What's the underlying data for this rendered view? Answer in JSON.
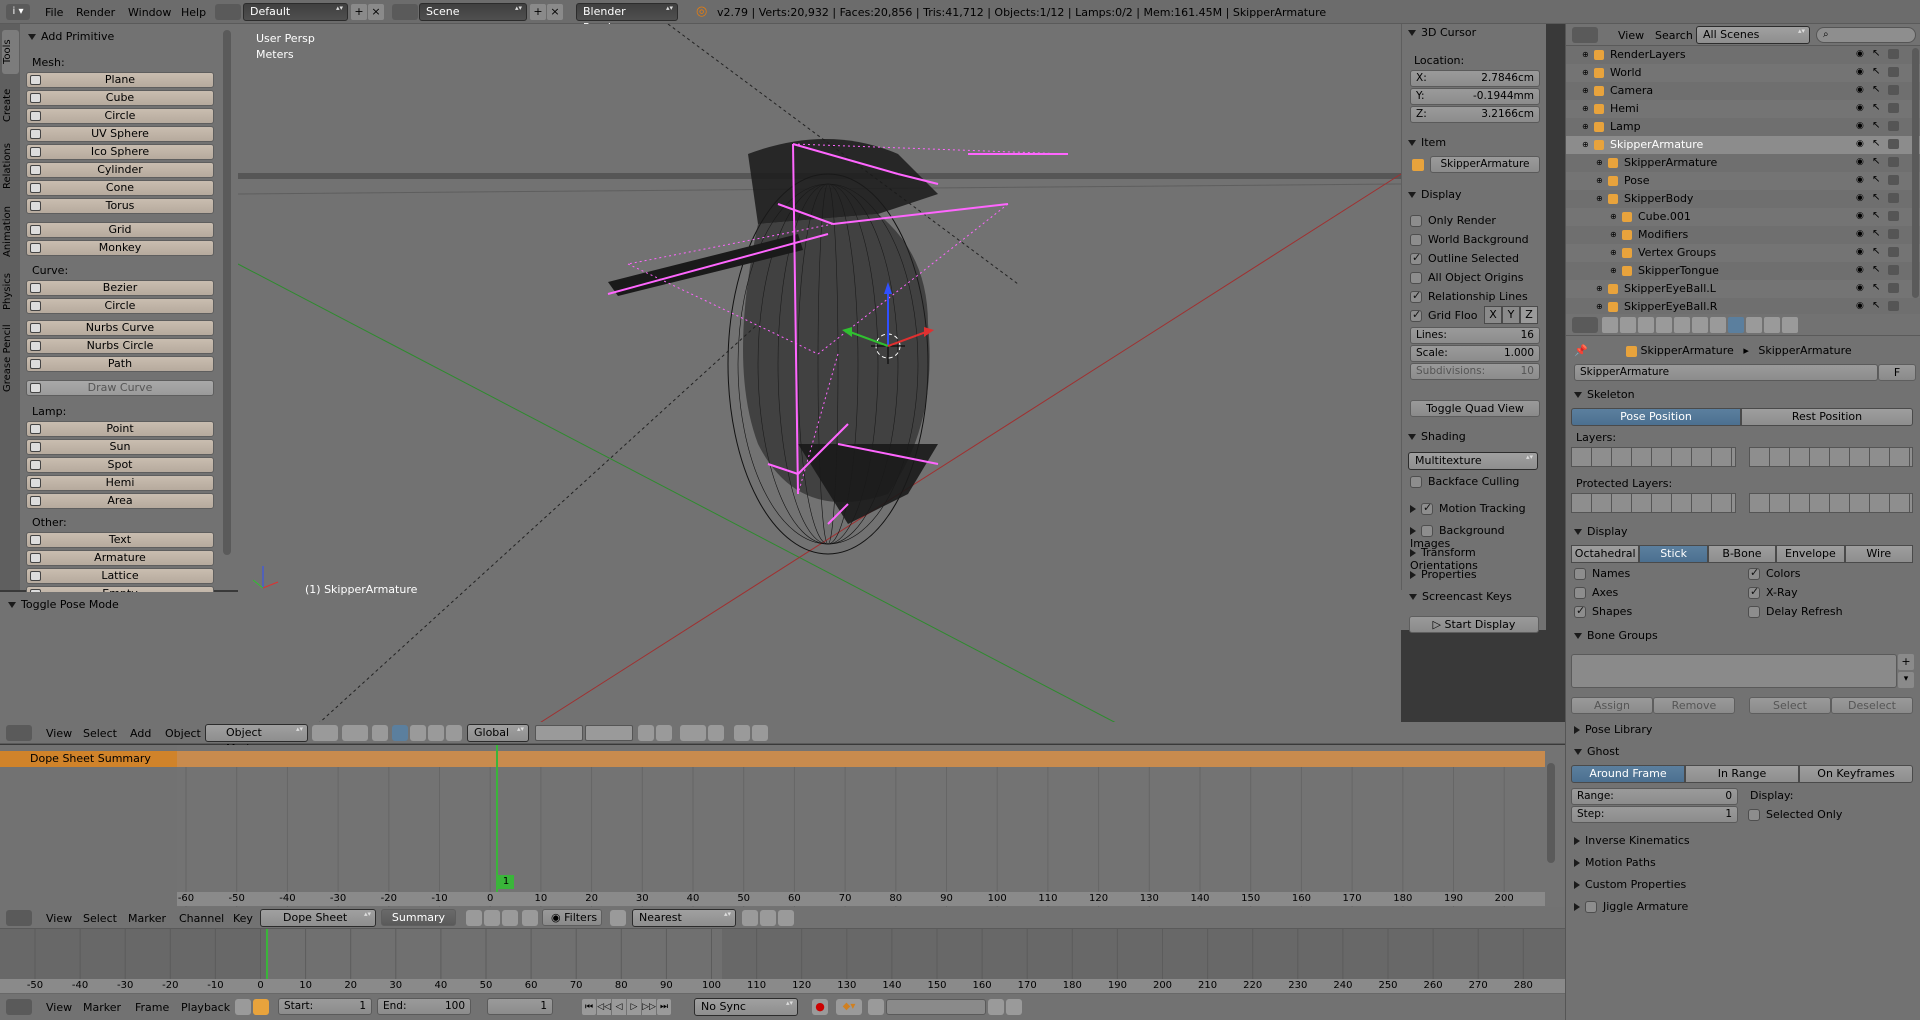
{
  "topbar": {
    "menus": [
      "File",
      "Render",
      "Window",
      "Help"
    ],
    "layout": "Default",
    "scene": "Scene",
    "engine": "Blender Render",
    "stats": "v2.79 | Verts:20,932 | Faces:20,856 | Tris:41,712 | Objects:1/12 | Lamps:0/2 | Mem:161.45M | SkipperArmature"
  },
  "toolshelf": {
    "tabs": [
      "Tools",
      "Create",
      "Relations",
      "Animation",
      "Physics",
      "Grease Pencil"
    ],
    "title": "Add Primitive",
    "mesh_label": "Mesh:",
    "mesh": [
      "Plane",
      "Cube",
      "Circle",
      "UV Sphere",
      "Ico Sphere",
      "Cylinder",
      "Cone",
      "Torus"
    ],
    "mesh2": [
      "Grid",
      "Monkey"
    ],
    "curve_label": "Curve:",
    "curve1": [
      "Bezier",
      "Circle"
    ],
    "curve2": [
      "Nurbs Curve",
      "Nurbs Circle",
      "Path"
    ],
    "draw_curve": "Draw Curve",
    "lamp_label": "Lamp:",
    "lamp": [
      "Point",
      "Sun",
      "Spot",
      "Hemi",
      "Area"
    ],
    "other_label": "Other:",
    "other": [
      "Text",
      "Armature",
      "Lattice",
      "Empty"
    ],
    "operator": "Toggle Pose Mode"
  },
  "viewport": {
    "view_name": "User Persp",
    "units": "Meters",
    "object_label": "(1) SkipperArmature",
    "header_menus": [
      "View",
      "Select",
      "Add",
      "Object"
    ],
    "mode": "Object Mode",
    "orientation": "Global"
  },
  "properties_n": {
    "cursor_title": "3D Cursor",
    "location": "Location:",
    "x": "X:",
    "xv": "2.7846cm",
    "y": "Y:",
    "yv": "-0.1944mm",
    "z": "Z:",
    "zv": "3.2166cm",
    "item_title": "Item",
    "item_name": "SkipperArmature",
    "display_title": "Display",
    "opts": [
      {
        "label": "Only Render",
        "on": false
      },
      {
        "label": "World Background",
        "on": false
      },
      {
        "label": "Outline Selected",
        "on": true
      },
      {
        "label": "All Object Origins",
        "on": false
      },
      {
        "label": "Relationship Lines",
        "on": true
      }
    ],
    "grid_floor": "Grid Floo",
    "axes": [
      "X",
      "Y",
      "Z"
    ],
    "lines_l": "Lines:",
    "lines_v": "16",
    "scale_l": "Scale:",
    "scale_v": "1.000",
    "subdiv_l": "Subdivisions:",
    "subdiv_v": "10",
    "quad": "Toggle Quad View",
    "shading_title": "Shading",
    "shading_mode": "Multitexture",
    "backface": "Backface Culling",
    "motion_tracking": "Motion Tracking",
    "background_images": "Background Images",
    "transform_orient": "Transform Orientations",
    "properties": "Properties",
    "screencast": "Screencast Keys",
    "start_display": "Start Display"
  },
  "outliner": {
    "menus": [
      "View",
      "Search"
    ],
    "filter": "All Scenes",
    "items": [
      {
        "name": "RenderLayers",
        "indent": 1
      },
      {
        "name": "World",
        "indent": 1
      },
      {
        "name": "Camera",
        "indent": 1
      },
      {
        "name": "Hemi",
        "indent": 1
      },
      {
        "name": "Lamp",
        "indent": 1
      },
      {
        "name": "SkipperArmature",
        "indent": 1,
        "sel": true
      },
      {
        "name": "SkipperArmature",
        "indent": 2
      },
      {
        "name": "Pose",
        "indent": 2
      },
      {
        "name": "SkipperBody",
        "indent": 2
      },
      {
        "name": "Cube.001",
        "indent": 3
      },
      {
        "name": "Modifiers",
        "indent": 3
      },
      {
        "name": "Vertex Groups",
        "indent": 3
      },
      {
        "name": "SkipperTongue",
        "indent": 3
      },
      {
        "name": "SkipperEyeBall.L",
        "indent": 2
      },
      {
        "name": "SkipperEyeBall.R",
        "indent": 2
      }
    ]
  },
  "props": {
    "breadcrumb1": "SkipperArmature",
    "breadcrumb2": "SkipperArmature",
    "name": "SkipperArmature",
    "fake": "F",
    "skeleton": "Skeleton",
    "pose_position": "Pose Position",
    "rest_position": "Rest Position",
    "layers": "Layers:",
    "protected_layers": "Protected Layers:",
    "display": "Display",
    "display_modes": [
      "Octahedral",
      "Stick",
      "B-Bone",
      "Envelope",
      "Wire"
    ],
    "names": "Names",
    "axes": "Axes",
    "shapes": "Shapes",
    "colors": "Colors",
    "xray": "X-Ray",
    "delay": "Delay Refresh",
    "bone_groups": "Bone Groups",
    "assign": "Assign",
    "remove": "Remove",
    "select": "Select",
    "deselect": "Deselect",
    "pose_library": "Pose Library",
    "ghost": "Ghost",
    "ghost_modes": [
      "Around Frame",
      "In Range",
      "On Keyframes"
    ],
    "range_l": "Range:",
    "range_v": "0",
    "step_l": "Step:",
    "step_v": "1",
    "display_l": "Display:",
    "selected_only": "Selected Only",
    "ik": "Inverse Kinematics",
    "motion_paths": "Motion Paths",
    "custom_props": "Custom Properties",
    "jiggle": "Jiggle Armature"
  },
  "dopesheet": {
    "summary": "Dope Sheet Summary",
    "ticks": [
      "-60",
      "-50",
      "-40",
      "-30",
      "-20",
      "-10",
      "0",
      "10",
      "20",
      "30",
      "40",
      "50",
      "60",
      "70",
      "80",
      "90",
      "100",
      "110",
      "120",
      "130",
      "140",
      "150",
      "160",
      "170",
      "180",
      "190",
      "200"
    ],
    "frame_badge": "1",
    "menus": [
      "View",
      "Select",
      "Marker",
      "Channel",
      "Key"
    ],
    "mode": "Dope Sheet",
    "summary_btn": "Summary",
    "filters": "Filters",
    "snap": "Nearest Frame"
  },
  "timeline": {
    "ticks": [
      "-50",
      "-40",
      "-30",
      "-20",
      "-10",
      "0",
      "10",
      "20",
      "30",
      "40",
      "50",
      "60",
      "70",
      "80",
      "90",
      "100",
      "110",
      "120",
      "130",
      "140",
      "150",
      "160",
      "170",
      "180",
      "190",
      "200",
      "210",
      "220",
      "230",
      "240",
      "250",
      "260",
      "270",
      "280"
    ],
    "menus": [
      "View",
      "Marker",
      "Frame",
      "Playback"
    ],
    "start_l": "Start:",
    "start_v": "1",
    "end_l": "End:",
    "end_v": "100",
    "current": "1",
    "sync": "No Sync"
  }
}
